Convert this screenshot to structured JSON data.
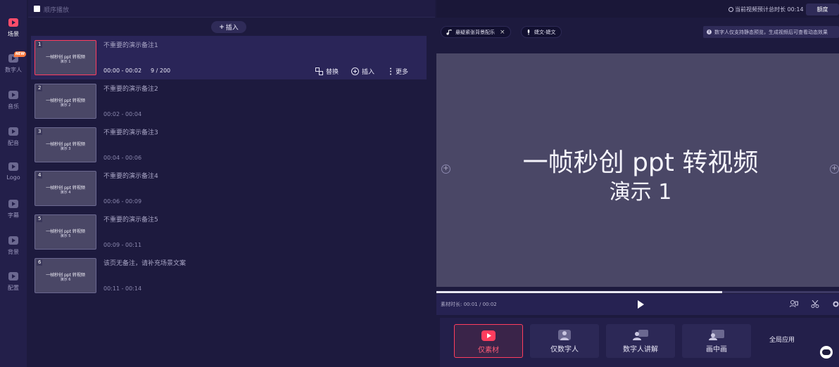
{
  "nav": {
    "items": [
      {
        "label": "场景",
        "icon": "scene-icon",
        "active": true
      },
      {
        "label": "数字人",
        "icon": "avatar-icon",
        "badge": "NEW"
      },
      {
        "label": "音乐",
        "icon": "music-icon"
      },
      {
        "label": "配音",
        "icon": "dubbing-icon"
      },
      {
        "label": "Logo",
        "icon": "logo-icon"
      },
      {
        "label": "字幕",
        "icon": "subtitle-icon"
      },
      {
        "label": "背景",
        "icon": "background-icon"
      },
      {
        "label": "配置",
        "icon": "config-icon"
      }
    ]
  },
  "panel": {
    "sequential_label": "顺序播放",
    "insert_top": "插入"
  },
  "scenes": [
    {
      "num": "1",
      "note": "不重要的演示备注1",
      "time": "00:00 - 00:02",
      "count": "9 / 200",
      "thumb_l1": "一帧秒创  ppt 转视频",
      "thumb_l2": "演示 1",
      "selected": true
    },
    {
      "num": "2",
      "note": "不重要的演示备注2",
      "time": "00:02 - 00:04",
      "thumb_l1": "一帧秒创  ppt 转视频",
      "thumb_l2": "演示 2"
    },
    {
      "num": "3",
      "note": "不重要的演示备注3",
      "time": "00:04 - 00:06",
      "thumb_l1": "一帧秒创  ppt 转视频",
      "thumb_l2": "演示 3"
    },
    {
      "num": "4",
      "note": "不重要的演示备注4",
      "time": "00:06 - 00:09",
      "thumb_l1": "一帧秒创  ppt 转视频",
      "thumb_l2": "演示 4"
    },
    {
      "num": "5",
      "note": "不重要的演示备注5",
      "time": "00:09 - 00:11",
      "thumb_l1": "一帧秒创  ppt 转视频",
      "thumb_l2": "演示 5"
    },
    {
      "num": "6",
      "note": "该页无备注，请补充场景文案",
      "time": "00:11 - 00:14",
      "thumb_l1": "一帧秒创  ppt 转视频",
      "thumb_l2": "演示 6"
    }
  ],
  "scene_actions": {
    "replace": "替换",
    "insert": "插入",
    "more": "更多"
  },
  "preview": {
    "total_duration": "当前视频预计总时长 00:14",
    "quota": "额度",
    "music_pill": "悬疑紧张背景配乐",
    "voice_pill": "婕文-婕文",
    "tip": "数字人仅支持静态预览，生成视频后可查看动态效果",
    "slide_title": "一帧秒创   ppt 转视频",
    "slide_sub": "演示 1",
    "material_duration": "素材时长: 00:01 / 00:02",
    "progress": 0.71
  },
  "modes": {
    "items": [
      {
        "label": "仅素材",
        "active": true
      },
      {
        "label": "仅数字人"
      },
      {
        "label": "数字人讲解"
      },
      {
        "label": "画中画"
      }
    ],
    "global_apply": "全局应用"
  },
  "colors": {
    "accent": "#ff3d5e",
    "panel": "#231f4a",
    "canvas": "#4a4766"
  }
}
